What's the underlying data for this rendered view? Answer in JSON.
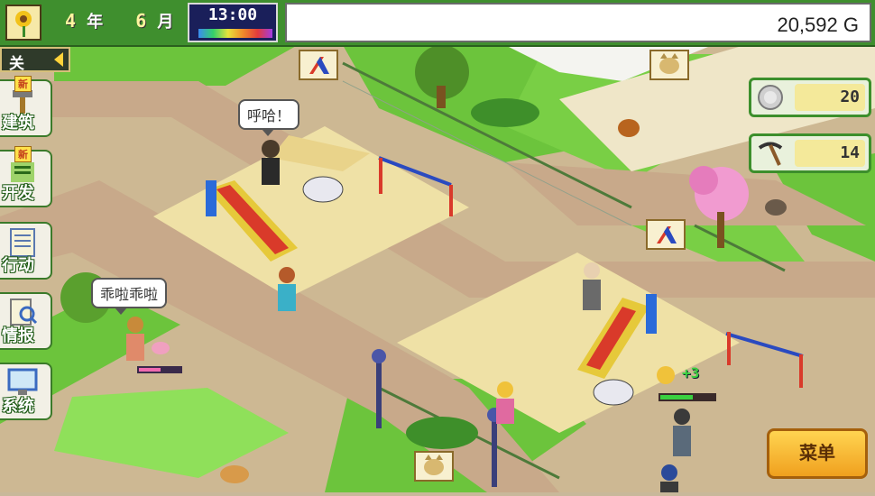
{
  "hud": {
    "year_value": "4",
    "year_unit": "年",
    "month_value": "6",
    "month_unit": "月",
    "time": "13:00",
    "money": "20,592",
    "money_unit": "G",
    "close_label": "关"
  },
  "sidebar": {
    "new_badge": "新",
    "items": [
      {
        "label": "建筑",
        "icon": "hammer-icon"
      },
      {
        "label": "开发",
        "icon": "research-icon"
      },
      {
        "label": "行动",
        "icon": "clipboard-icon"
      },
      {
        "label": "情报",
        "icon": "magnifier-icon"
      },
      {
        "label": "系统",
        "icon": "computer-icon"
      }
    ]
  },
  "resources": {
    "medals": "20",
    "pickaxe": "14"
  },
  "bubbles": {
    "speech_1": "呼哈！",
    "speech_2": "乖啦乖啦"
  },
  "effects": {
    "plus": "+3"
  },
  "menu": {
    "label": "菜单"
  },
  "colors": {
    "grass": "#6cc43c",
    "path": "#d2b893",
    "sand": "#efe1a6",
    "menu_button": "#f5b62b"
  }
}
